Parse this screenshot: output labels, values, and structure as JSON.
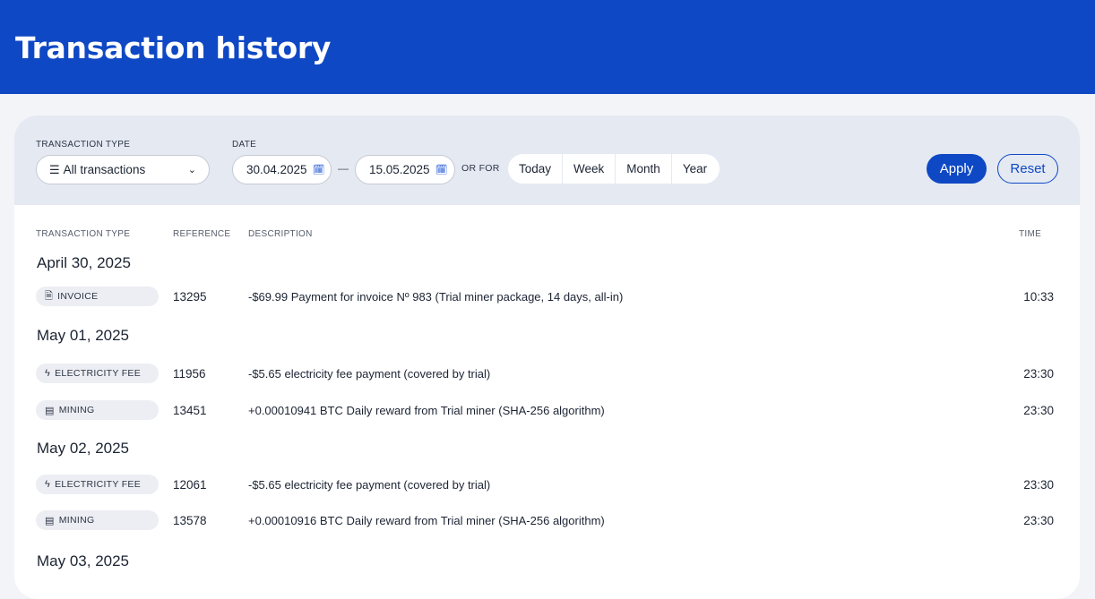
{
  "header": {
    "title": "Transaction history"
  },
  "filters": {
    "type_label": "TRANSACTION TYPE",
    "type_value": "All transactions",
    "date_label": "DATE",
    "date_from": "30.04.2025",
    "date_to": "15.05.2025",
    "dash": "—",
    "or_for": "OR FOR",
    "periods": [
      "Today",
      "Week",
      "Month",
      "Year"
    ],
    "apply": "Apply",
    "reset": "Reset"
  },
  "table": {
    "headers": {
      "type": "TRANSACTION TYPE",
      "reference": "REFERENCE",
      "description": "DESCRIPTION",
      "time": "TIME"
    },
    "groups": [
      {
        "date": "April 30, 2025",
        "rows": [
          {
            "type": "INVOICE",
            "icon": "invoice-icon",
            "reference": "13295",
            "description": "-$69.99 Payment for invoice Nº 983 (Trial miner package, 14 days, all-in)",
            "time": "10:33"
          }
        ]
      },
      {
        "date": "May 01, 2025",
        "rows": [
          {
            "type": "ELECTRICITY FEE",
            "icon": "lightning-icon",
            "reference": "11956",
            "description": "-$5.65 electricity fee payment (covered by trial)",
            "time": "23:30"
          },
          {
            "type": "MINING",
            "icon": "server-icon",
            "reference": "13451",
            "description": "+0.00010941 BTC Daily reward from Trial miner (SHA-256 algorithm)",
            "time": "23:30"
          }
        ]
      },
      {
        "date": "May 02, 2025",
        "rows": [
          {
            "type": "ELECTRICITY FEE",
            "icon": "lightning-icon",
            "reference": "12061",
            "description": "-$5.65 electricity fee payment (covered by trial)",
            "time": "23:30"
          },
          {
            "type": "MINING",
            "icon": "server-icon",
            "reference": "13578",
            "description": "+0.00010916 BTC Daily reward from Trial miner (SHA-256 algorithm)",
            "time": "23:30"
          }
        ]
      },
      {
        "date": "May 03, 2025",
        "rows": []
      }
    ]
  }
}
